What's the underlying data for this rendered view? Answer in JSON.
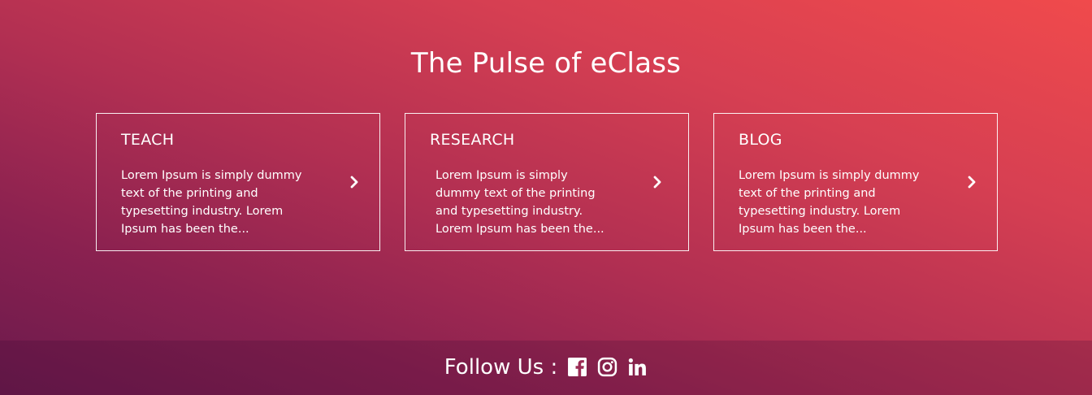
{
  "section": {
    "title": "The Pulse of eClass"
  },
  "cards": [
    {
      "heading": "TEACH",
      "body": "Lorem Ipsum is simply dummy text of the printing and typesetting industry. Lorem Ipsum has been the...",
      "icon": "chevron-right-icon"
    },
    {
      "heading": "RESEARCH",
      "body": "Lorem Ipsum is simply dummy text of the printing and typesetting industry. Lorem Ipsum has been the...",
      "icon": "chevron-right-icon"
    },
    {
      "heading": "BLOG",
      "body": "Lorem Ipsum is simply dummy text of the printing and typesetting industry. Lorem Ipsum has been the...",
      "icon": "chevron-right-icon"
    }
  ],
  "footer": {
    "follow_label": "Follow Us :",
    "social": [
      {
        "icon": "facebook-icon"
      },
      {
        "icon": "instagram-icon"
      },
      {
        "icon": "linkedin-icon"
      }
    ]
  },
  "colors": {
    "gradient_top_right": "#f04a4c",
    "gradient_bottom_left": "#6a1a4c",
    "text": "#ffffff"
  }
}
